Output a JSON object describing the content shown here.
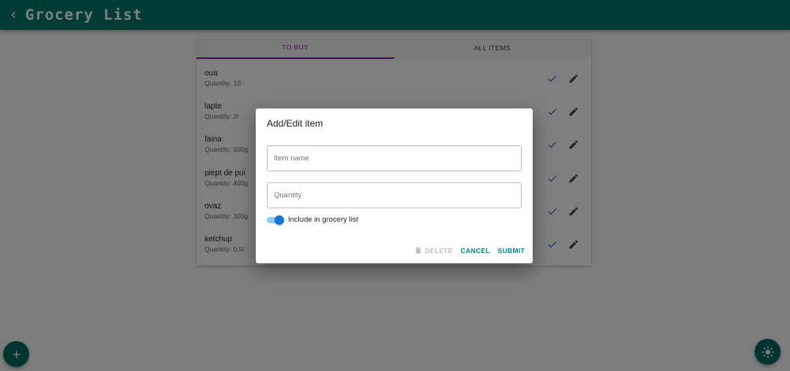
{
  "app": {
    "title": "Grocery List"
  },
  "tabs": [
    {
      "label": "TO BUY"
    },
    {
      "label": "ALL ITEMS"
    }
  ],
  "items": [
    {
      "name": "oua",
      "quantity": "Quantity: 10"
    },
    {
      "name": "lapte",
      "quantity": "Quantity: 2l"
    },
    {
      "name": "faina",
      "quantity": "Quantity: 500g"
    },
    {
      "name": "piept de pui",
      "quantity": "Quantity: 400g"
    },
    {
      "name": "ovaz",
      "quantity": "Quantity: 300g"
    },
    {
      "name": "ketchup",
      "quantity": "Quantity: 0,5l"
    }
  ],
  "dialog": {
    "title": "Add/Edit item",
    "item_name": {
      "placeholder": "Item name",
      "value": ""
    },
    "quantity": {
      "placeholder": "Quantity",
      "value": ""
    },
    "toggle": {
      "label": "Include in grocery list",
      "checked": true
    },
    "buttons": {
      "delete": "DELETE",
      "cancel": "CANCEL",
      "submit": "SUBMIT"
    }
  },
  "icons": {
    "back": "chevron-left-icon",
    "check": "check-icon",
    "edit": "pencil-icon",
    "delete": "trash-icon",
    "add": "plus-icon",
    "theme": "sun-icon"
  },
  "colors": {
    "primary": "#00796b",
    "tab_active": "#8e24aa",
    "check": "#1976d2",
    "action_text": "#00897b"
  }
}
